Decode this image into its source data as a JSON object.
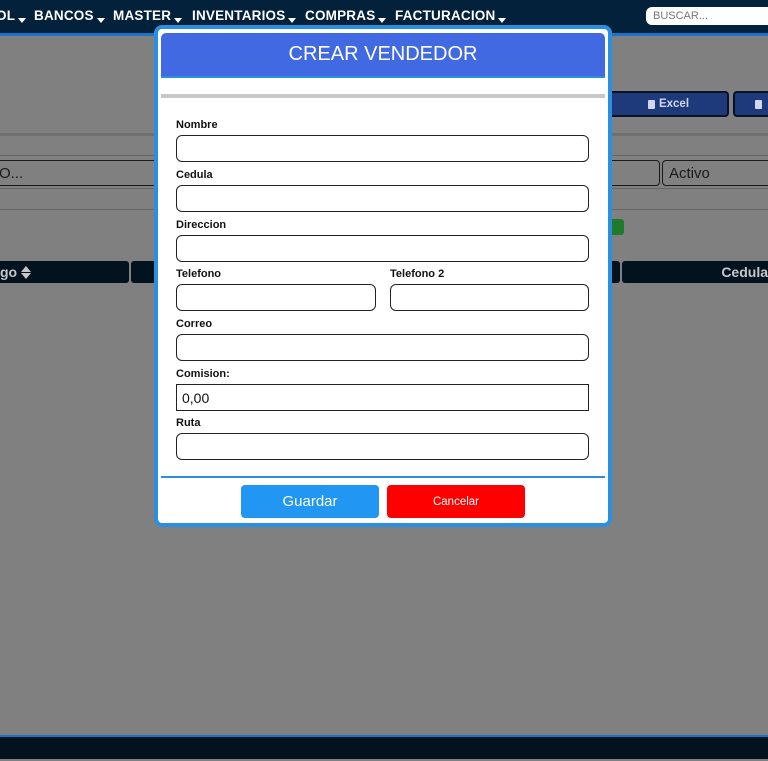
{
  "nav": {
    "items": [
      {
        "label": "OL"
      },
      {
        "label": "BANCOS"
      },
      {
        "label": "MASTER"
      },
      {
        "label": "INVENTARIOS"
      },
      {
        "label": "COMPRAS"
      },
      {
        "label": "FACTURACION"
      }
    ],
    "search_placeholder": "BUSCAR..."
  },
  "page": {
    "excel_label": "Excel",
    "search_value_partial": "O...",
    "status_value": "Activo",
    "columns": {
      "codigo_partial": "go",
      "cedula_partial": "Cedula"
    }
  },
  "modal": {
    "title": "CREAR VENDEDOR",
    "fields": {
      "nombre": {
        "label": "Nombre",
        "value": ""
      },
      "cedula": {
        "label": "Cedula",
        "value": ""
      },
      "direccion": {
        "label": "Direccion",
        "value": ""
      },
      "telefono": {
        "label": "Telefono",
        "value": ""
      },
      "telefono2": {
        "label": "Telefono 2",
        "value": ""
      },
      "correo": {
        "label": "Correo",
        "value": ""
      },
      "comision": {
        "label": "Comision:",
        "value": "0,00"
      },
      "ruta": {
        "label": "Ruta",
        "value": ""
      }
    },
    "save_label": "Guardar",
    "cancel_label": "Cancelar"
  },
  "colors": {
    "nav_bg": "#03213a",
    "accent": "#2b8fe0",
    "modal_header": "#4169e1",
    "save": "#2196f3",
    "cancel": "#ff0000",
    "overlay": "#808080"
  }
}
